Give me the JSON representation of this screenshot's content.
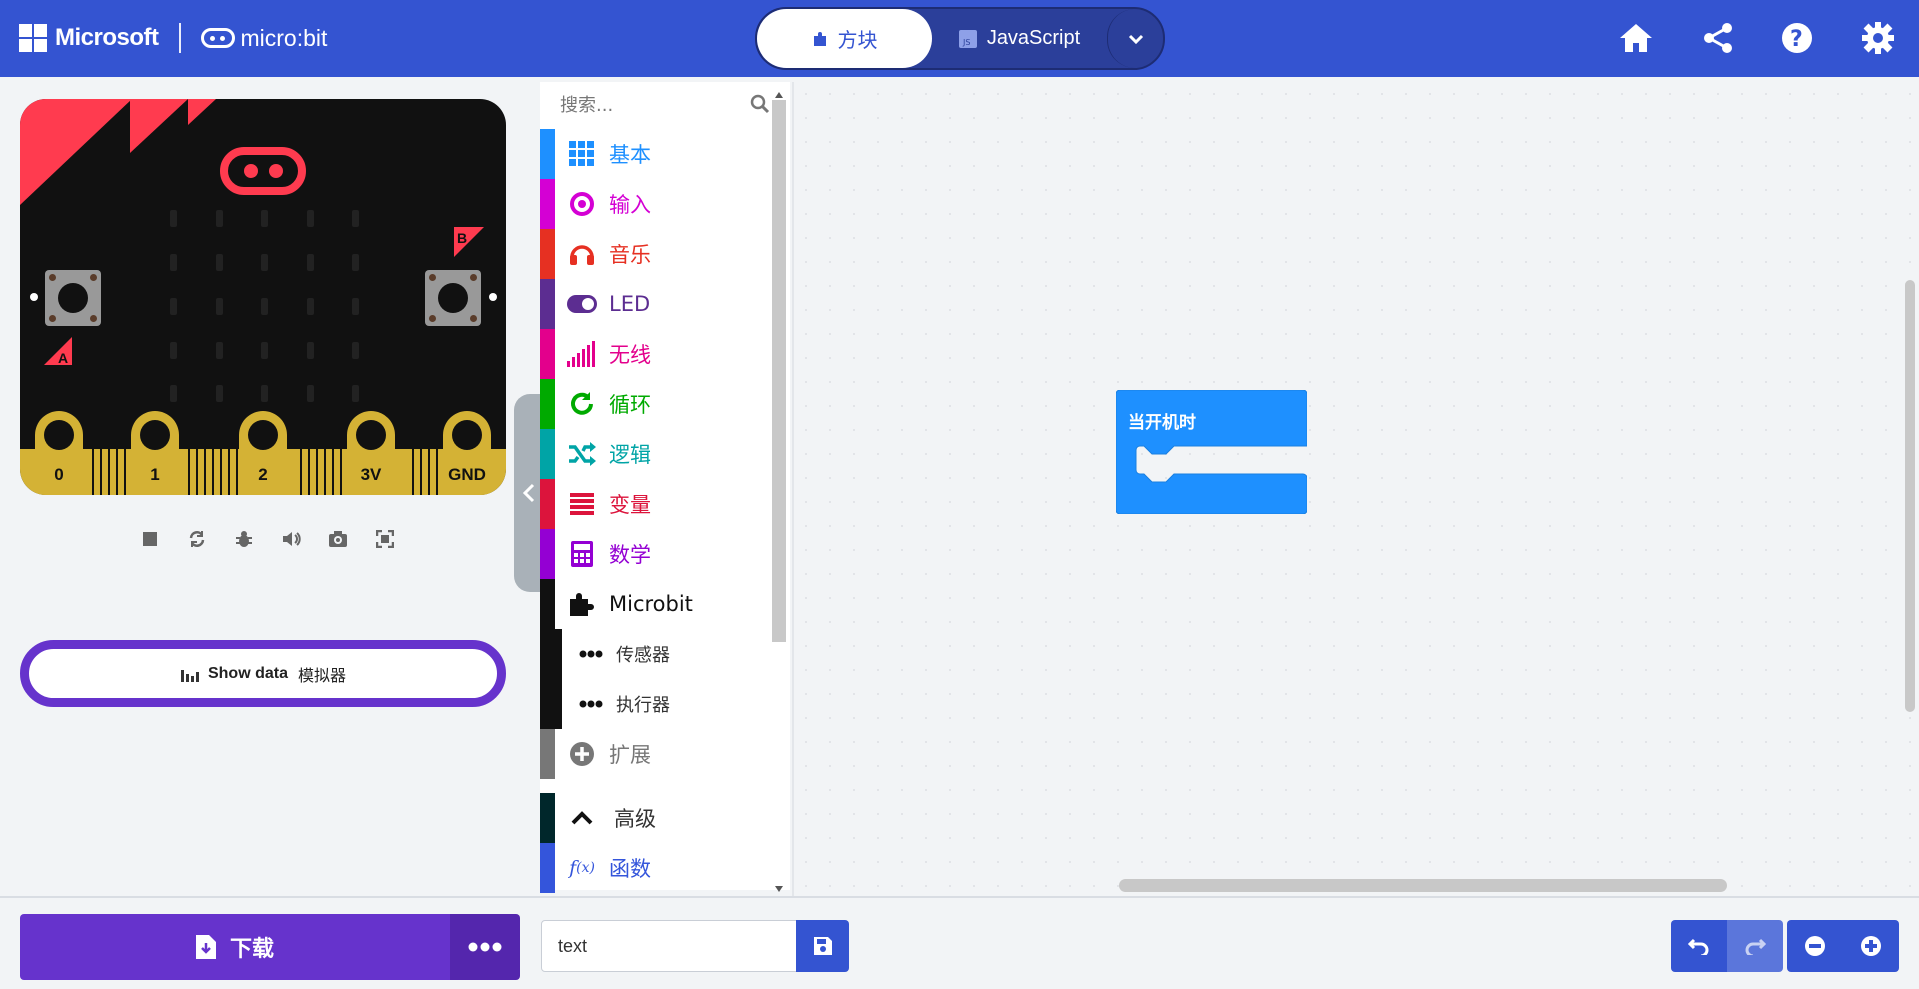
{
  "header": {
    "microsoft_label": "Microsoft",
    "microbit_label": "micro:bit",
    "mode_blocks": "方块",
    "mode_js": "JavaScript"
  },
  "search": {
    "placeholder": "搜索..."
  },
  "toolbox": [
    {
      "label": "基本",
      "color": "#1e90ff",
      "icon": "grid-icon"
    },
    {
      "label": "输入",
      "color": "#d400d4",
      "icon": "target-icon"
    },
    {
      "label": "音乐",
      "color": "#e63022",
      "icon": "headphones-icon"
    },
    {
      "label": "LED",
      "color": "#5c2d91",
      "icon": "toggle-icon"
    },
    {
      "label": "无线",
      "color": "#e3008c",
      "icon": "signal-icon"
    },
    {
      "label": "循环",
      "color": "#00aa00",
      "icon": "refresh-icon"
    },
    {
      "label": "逻辑",
      "color": "#00a4a6",
      "icon": "shuffle-icon"
    },
    {
      "label": "变量",
      "color": "#dc143c",
      "icon": "list-icon"
    },
    {
      "label": "数学",
      "color": "#9400d3",
      "icon": "calculator-icon"
    },
    {
      "label": "Microbit",
      "color": "#111111",
      "icon": "puzzle-icon"
    },
    {
      "label": "传感器",
      "color": "#111111",
      "icon": "dots-icon"
    },
    {
      "label": "执行器",
      "color": "#111111",
      "icon": "dots-icon"
    },
    {
      "label": "扩展",
      "color": "#777777",
      "icon": "plus-circle-icon"
    },
    {
      "label": "高级",
      "color": "#00272b",
      "icon": "chevron-up-icon"
    },
    {
      "label": "函数",
      "color": "#3455db",
      "icon": "function-icon"
    }
  ],
  "simulator": {
    "pins": [
      "0",
      "1",
      "2",
      "3V",
      "GND"
    ],
    "button_a": "A",
    "button_b": "B",
    "show_data_label": "Show data",
    "show_data_sub": "模拟器"
  },
  "workspace": {
    "block_label": "当开机时"
  },
  "footer": {
    "download_label": "下载",
    "project_name": "text"
  }
}
